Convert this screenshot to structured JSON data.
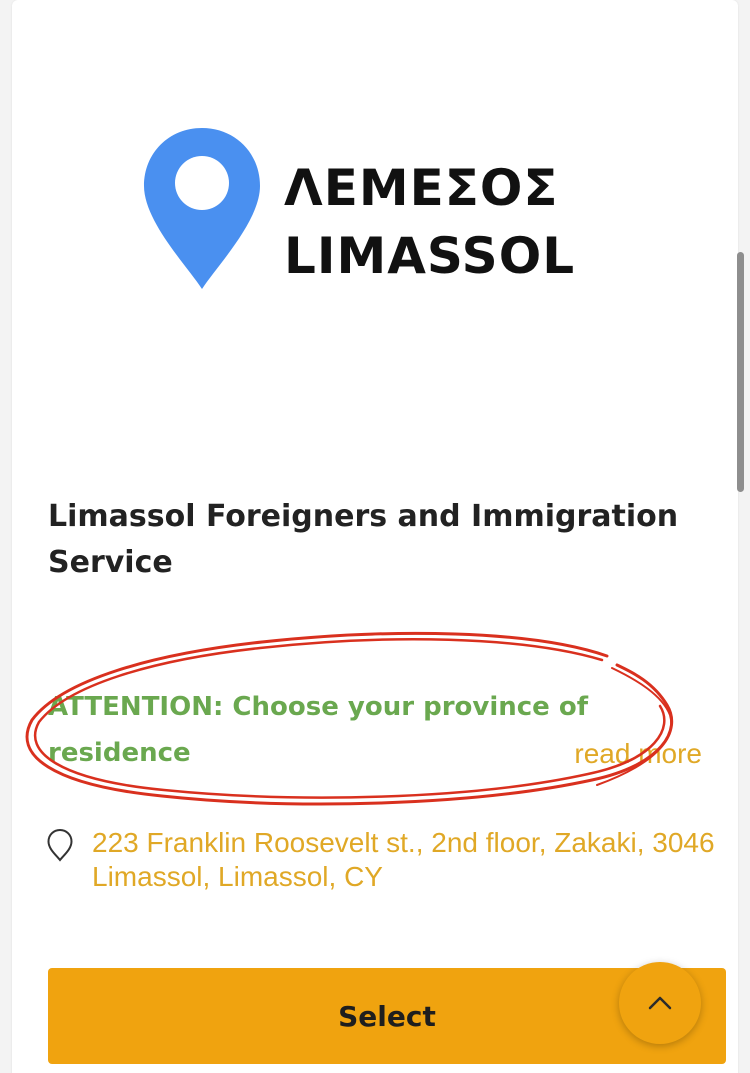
{
  "logo": {
    "line1": "ΛΕΜΕΣΟΣ",
    "line2": "LIMASSOL",
    "pin_color": "#4a90f0",
    "icon": "map-pin-icon"
  },
  "office": {
    "title": "Limassol Foreigners and Immigration Service",
    "attention": "ATTENTION: Choose your province of residence",
    "read_more": "read more",
    "address": "223 Franklin Roosevelt st., 2nd floor, Zakaki, 3046 Limassol, Limassol, CY",
    "address_icon": "location-pin-outline-icon"
  },
  "actions": {
    "select_label": "Select",
    "scroll_top_icon": "chevron-up-icon"
  },
  "colors": {
    "accent": "#f0a30f",
    "link": "#e0a826",
    "attention": "#6aa84f",
    "annotation": "#d9301e"
  }
}
